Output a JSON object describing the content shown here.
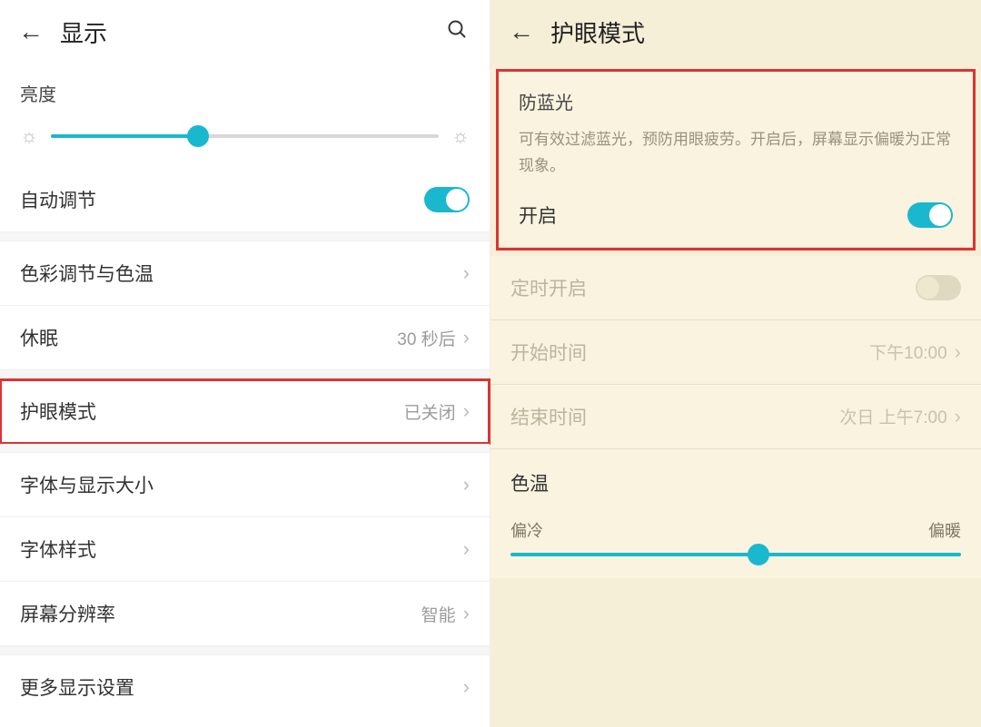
{
  "left": {
    "header": {
      "title": "显示"
    },
    "brightness": {
      "label": "亮度",
      "percent": 38
    },
    "autoAdjust": {
      "label": "自动调节",
      "on": true
    },
    "rows": {
      "color": {
        "label": "色彩调节与色温"
      },
      "sleep": {
        "label": "休眠",
        "value": "30 秒后"
      },
      "eyeMode": {
        "label": "护眼模式",
        "value": "已关闭"
      },
      "fontSize": {
        "label": "字体与显示大小"
      },
      "fontStyle": {
        "label": "字体样式"
      },
      "resolution": {
        "label": "屏幕分辨率",
        "value": "智能"
      },
      "more": {
        "label": "更多显示设置"
      }
    }
  },
  "right": {
    "header": {
      "title": "护眼模式"
    },
    "blueLight": {
      "title": "防蓝光",
      "desc": "可有效过滤蓝光，预防用眼疲劳。开启后，屏幕显示偏暖为正常现象。",
      "enableLabel": "开启",
      "on": true
    },
    "schedule": {
      "timerLabel": "定时开启",
      "timerOn": false,
      "startLabel": "开始时间",
      "startValue": "下午10:00",
      "endLabel": "结束时间",
      "endValue": "次日 上午7:00"
    },
    "colorTemp": {
      "title": "色温",
      "coldLabel": "偏冷",
      "warmLabel": "偏暖",
      "percent": 55
    }
  }
}
